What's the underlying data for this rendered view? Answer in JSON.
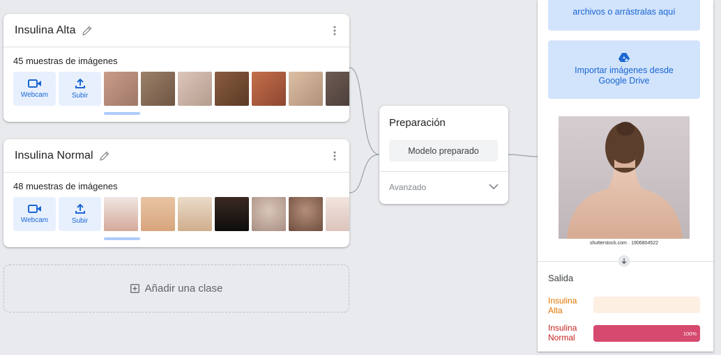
{
  "classes": [
    {
      "name": "Insulina Alta",
      "sample_count": "45 muestras de imágenes",
      "webcam_label": "Webcam",
      "upload_label": "Subir",
      "thumb_colors": [
        "#b48f7d",
        "#8a7058",
        "#cfb6a8",
        "#6f4a33",
        "#b0603f",
        "#c9a98c",
        "#5b4a44"
      ]
    },
    {
      "name": "Insulina Normal",
      "sample_count": "48 muestras de imágenes",
      "webcam_label": "Webcam",
      "upload_label": "Subir",
      "thumb_colors": [
        "#d4a998",
        "#e2b58f",
        "#ddc2a2",
        "#1c1a19",
        "#c8b1a4",
        "#a0796a",
        "#e6d2cc"
      ]
    }
  ],
  "add_class_label": "Añadir una clase",
  "training": {
    "title": "Preparación",
    "button_label": "Modelo preparado",
    "advanced_label": "Avanzado"
  },
  "preview": {
    "upload_text": "archivos o arrástralas aquí",
    "drive_text_line1": "Importar imágenes desde",
    "drive_text_line2": "Google Drive",
    "watermark": "shutterstock.com · 1906804522",
    "output_title": "Salida",
    "outputs": [
      {
        "label": "Insulina Alta",
        "percent": 0,
        "color": "#e37400"
      },
      {
        "label": "Insulina Normal",
        "percent": 100,
        "percent_label": "100%",
        "color": "#d64a6f"
      }
    ]
  }
}
